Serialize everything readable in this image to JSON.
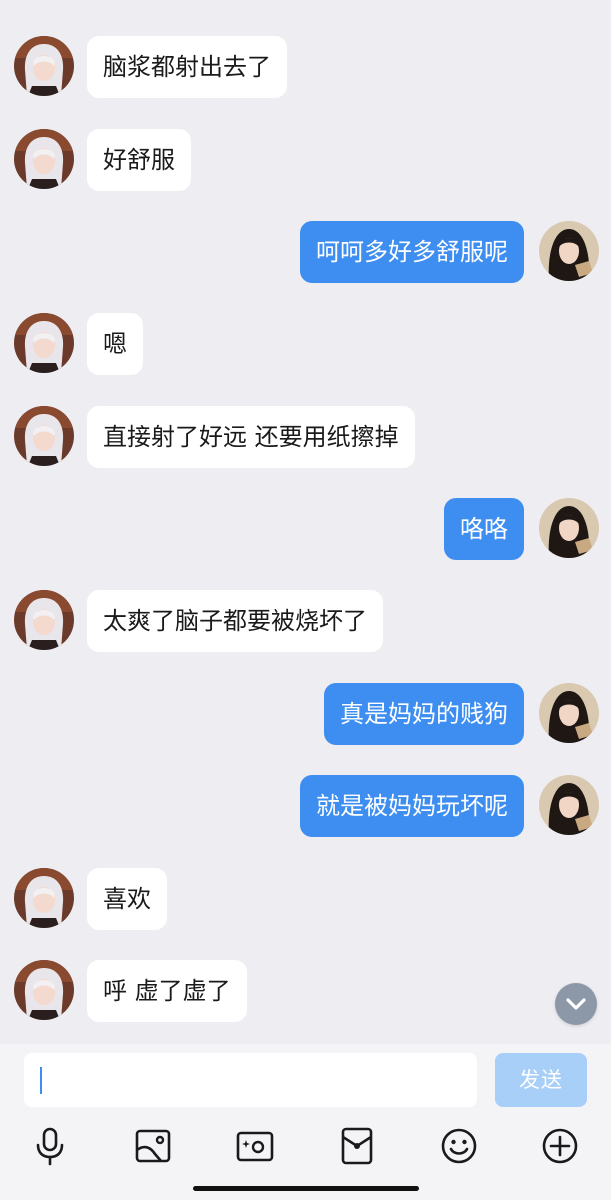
{
  "colors": {
    "background": "#EDEDF2",
    "incoming_bubble": "#FFFFFF",
    "outgoing_bubble": "#3D8EF0",
    "send_button_disabled": "#A8CFF7",
    "caret": "#3D8EF0"
  },
  "messages": [
    {
      "side": "left",
      "text": "脑浆都射出去了"
    },
    {
      "side": "left",
      "text": "好舒服"
    },
    {
      "side": "right",
      "text": "呵呵多好多舒服呢"
    },
    {
      "side": "left",
      "text": "嗯"
    },
    {
      "side": "left",
      "text": "直接射了好远 还要用纸擦掉"
    },
    {
      "side": "right",
      "text": "咯咯"
    },
    {
      "side": "left",
      "text": "太爽了脑子都要被烧坏了"
    },
    {
      "side": "right",
      "text": "真是妈妈的贱狗"
    },
    {
      "side": "right",
      "text": "就是被妈妈玩坏呢"
    },
    {
      "side": "left",
      "text": "喜欢"
    },
    {
      "side": "left",
      "text": "呼 虚了虚了"
    }
  ],
  "input": {
    "value": "",
    "send_label": "发送"
  },
  "toolbar": {
    "icons": [
      "microphone-icon",
      "image-icon",
      "camera-icon",
      "red-envelope-icon",
      "emoji-icon",
      "plus-icon"
    ]
  }
}
